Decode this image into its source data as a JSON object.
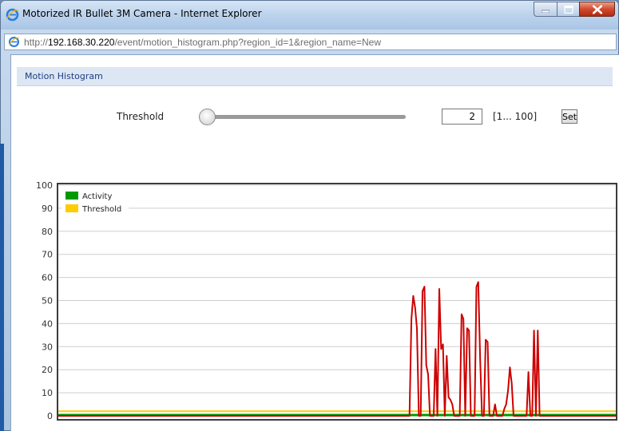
{
  "window": {
    "title": "Motorized IR Bullet 3M Camera - Internet Explorer",
    "icon": "ie-icon"
  },
  "address": {
    "prefix": "http://",
    "host": "192.168.30.220",
    "path": "/event/motion_histogram.php?region_id=1&region_name=New"
  },
  "panel": {
    "title": "Motion Histogram"
  },
  "threshold": {
    "label": "Threshold",
    "value": "2",
    "range_label": "[1... 100]",
    "set_label": "Set",
    "slider_value": 2,
    "slider_min": 1,
    "slider_max": 100
  },
  "colors": {
    "activity": "#009900",
    "threshold": "#ffcc00",
    "motion": "#cc0000"
  },
  "chart_data": {
    "type": "line",
    "ylim": [
      0,
      100
    ],
    "yticks": [
      "0",
      "10",
      "20",
      "30",
      "40",
      "50",
      "60",
      "70",
      "80",
      "90",
      "100"
    ],
    "legend": [
      "Activity",
      "Threshold"
    ],
    "legend_position": "top-left",
    "grid": true,
    "samples": 300,
    "threshold_value": 2,
    "activity_value": 0,
    "motion": [
      [
        0,
        0
      ],
      [
        189,
        0
      ],
      [
        190,
        42
      ],
      [
        191,
        52
      ],
      [
        192,
        47
      ],
      [
        193,
        38
      ],
      [
        194,
        0
      ],
      [
        195,
        0
      ],
      [
        196,
        54
      ],
      [
        197,
        56
      ],
      [
        198,
        22
      ],
      [
        199,
        18
      ],
      [
        200,
        0
      ],
      [
        201,
        0
      ],
      [
        202,
        0
      ],
      [
        203,
        29
      ],
      [
        204,
        0
      ],
      [
        205,
        55
      ],
      [
        206,
        29
      ],
      [
        207,
        31
      ],
      [
        208,
        0
      ],
      [
        209,
        26
      ],
      [
        210,
        8
      ],
      [
        211,
        7
      ],
      [
        212,
        5
      ],
      [
        213,
        0
      ],
      [
        214,
        0
      ],
      [
        215,
        0
      ],
      [
        216,
        0
      ],
      [
        217,
        44
      ],
      [
        218,
        42
      ],
      [
        219,
        0
      ],
      [
        220,
        38
      ],
      [
        221,
        37
      ],
      [
        222,
        0
      ],
      [
        223,
        0
      ],
      [
        224,
        0
      ],
      [
        225,
        56
      ],
      [
        226,
        58
      ],
      [
        227,
        24
      ],
      [
        228,
        0
      ],
      [
        229,
        0
      ],
      [
        230,
        33
      ],
      [
        231,
        32
      ],
      [
        232,
        0
      ],
      [
        233,
        0
      ],
      [
        234,
        0
      ],
      [
        235,
        5
      ],
      [
        236,
        0
      ],
      [
        237,
        0
      ],
      [
        238,
        0
      ],
      [
        239,
        0
      ],
      [
        240,
        3
      ],
      [
        241,
        5
      ],
      [
        242,
        11
      ],
      [
        243,
        21
      ],
      [
        244,
        14
      ],
      [
        245,
        0
      ],
      [
        246,
        0
      ],
      [
        247,
        0
      ],
      [
        248,
        0
      ],
      [
        249,
        0
      ],
      [
        250,
        0
      ],
      [
        251,
        0
      ],
      [
        252,
        0
      ],
      [
        253,
        19
      ],
      [
        254,
        0
      ],
      [
        255,
        0
      ],
      [
        256,
        37
      ],
      [
        257,
        0
      ],
      [
        258,
        37
      ],
      [
        259,
        0
      ],
      [
        300,
        0
      ]
    ]
  }
}
